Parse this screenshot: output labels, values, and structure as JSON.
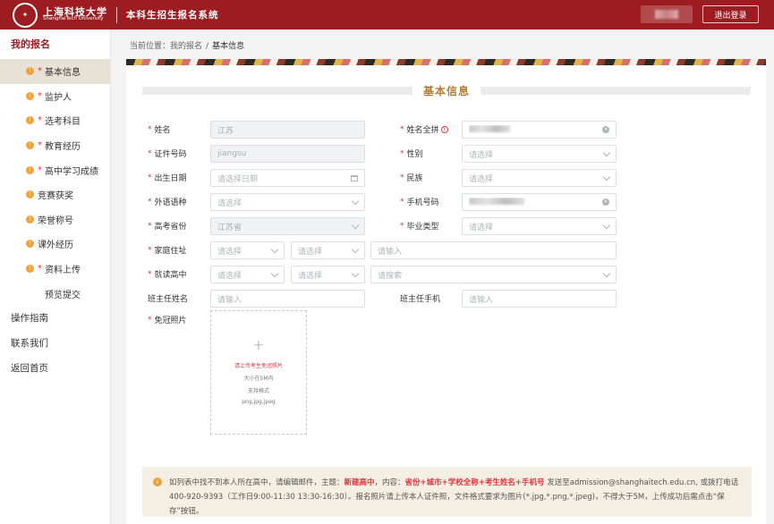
{
  "header": {
    "logo_cn": "上海科技大学",
    "logo_en": "ShanghaiTech University",
    "system_name": "本科生招生报名系统",
    "logout_label": "退出登录"
  },
  "sidebar": {
    "heading": "我的报名",
    "items": [
      {
        "label": "基本信息",
        "warn": true,
        "required": true,
        "active": true
      },
      {
        "label": "监护人",
        "warn": true,
        "required": true
      },
      {
        "label": "选考科目",
        "warn": true,
        "required": true
      },
      {
        "label": "教育经历",
        "warn": true,
        "required": true
      },
      {
        "label": "高中学习成绩",
        "warn": true,
        "required": true
      },
      {
        "label": "竞赛获奖",
        "warn": true,
        "required": false
      },
      {
        "label": "荣誉称号",
        "warn": true,
        "required": false
      },
      {
        "label": "课外经历",
        "warn": true,
        "required": false
      },
      {
        "label": "资料上传",
        "warn": true,
        "required": true
      },
      {
        "label": "预览提交",
        "warn": false,
        "required": false
      }
    ],
    "links": [
      "操作指南",
      "联系我们",
      "返回首页"
    ]
  },
  "breadcrumb": {
    "prefix": "当前位置：",
    "parent": "我的报名",
    "separator": "/",
    "current": "基本信息"
  },
  "form": {
    "title": "基本信息",
    "name": {
      "label": "姓名",
      "value": "江苏"
    },
    "full_pinyin": {
      "label": "姓名全拼"
    },
    "id_number": {
      "label": "证件号码",
      "value": "jiangsu"
    },
    "gender": {
      "label": "性别",
      "placeholder": "请选择"
    },
    "birth_date": {
      "label": "出生日期",
      "placeholder": "请选择日期"
    },
    "ethnicity": {
      "label": "民族",
      "placeholder": "请选择"
    },
    "foreign_language": {
      "label": "外语语种",
      "placeholder": "请选择"
    },
    "phone": {
      "label": "手机号码"
    },
    "exam_province": {
      "label": "高考省份",
      "value": "江苏省"
    },
    "graduation_type": {
      "label": "毕业类型",
      "placeholder": "请选择"
    },
    "home_address": {
      "label": "家庭住址",
      "province": "请选择",
      "city": "请选择",
      "detail": "请输入"
    },
    "high_school": {
      "label": "就读高中",
      "province": "请选择",
      "city": "请选择",
      "search": "请搜索"
    },
    "teacher_name": {
      "label": "班主任姓名",
      "placeholder": "请输入"
    },
    "teacher_phone": {
      "label": "班主任手机",
      "placeholder": "请输入"
    },
    "photo": {
      "label": "免冠照片",
      "tip": "请上传考生免冠照片",
      "size": "大小在5M内",
      "format_label": "支持格式",
      "formats": "png,jpg,jpeg"
    }
  },
  "notice": {
    "text1": "如列表中找不到本人所在高中，请编辑邮件，主题：",
    "subject": "新建高中",
    "text2": "，内容：",
    "content": "省份+城市+学校全称+考生姓名+手机号",
    "text3": " 发送至admission@shanghaitech.edu.cn, 或拨打电话400-920-9393（工作日9:00-11:30 13:30-16:30）。报名照片请上传本人证件照，文件格式要求为图片(*.jpg,*.png,*.jpeg)，不得大于5M，上传成功后需点击“保存”按钮。"
  },
  "colors": {
    "brand": "#9c1c22",
    "gold": "#b07d2e",
    "required": "#d9363e",
    "active_bg": "#e8e2d6"
  }
}
